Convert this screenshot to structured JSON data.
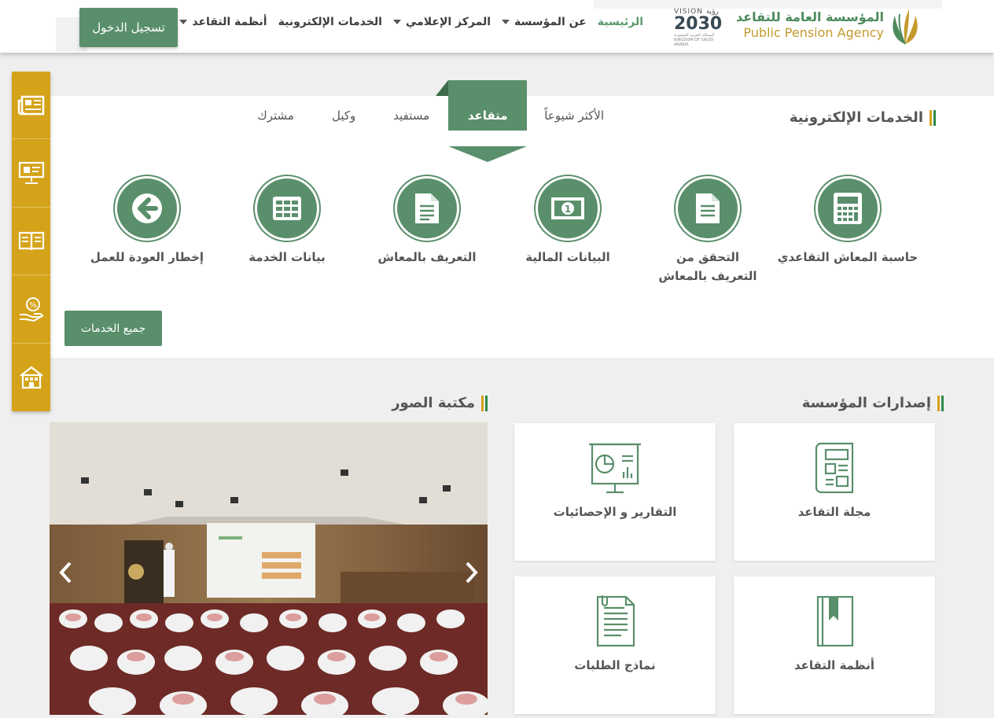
{
  "header": {
    "login_label": "تسجيل الدخول",
    "nav": [
      {
        "label": "الرئيسية",
        "active": true,
        "dropdown": false
      },
      {
        "label": "عن المؤسسة",
        "active": false,
        "dropdown": true
      },
      {
        "label": "المركز الإعلامي",
        "active": false,
        "dropdown": true
      },
      {
        "label": "الخدمات الإلكترونية",
        "active": false,
        "dropdown": false
      },
      {
        "label": "أنظمة التقاعد",
        "active": false,
        "dropdown": true
      }
    ],
    "vision": {
      "top": "VISION رؤية",
      "year": "2030",
      "sub": "المملكة العربية السعودية KINGDOM OF SAUDI ARABIA"
    },
    "logo": {
      "arabic": "المؤسسة العامة للتقاعد",
      "english": "Public Pension Agency"
    }
  },
  "sidebar": {
    "items": [
      {
        "icon": "newspaper-icon"
      },
      {
        "icon": "presentation-icon"
      },
      {
        "icon": "book-icon"
      },
      {
        "icon": "percent-hand-icon"
      },
      {
        "icon": "building-icon"
      }
    ]
  },
  "services": {
    "title": "الخدمات الإلكترونية",
    "tabs": [
      "الأكثر شيوعاً",
      "متقاعد",
      "مستفيد",
      "وكيل",
      "مشترك"
    ],
    "active_tab": "متقاعد",
    "items": [
      {
        "label": "حاسبة المعاش التقاعدي",
        "icon": "calculator-icon"
      },
      {
        "label": "التحقق من التعريف بالمعاش",
        "icon": "document-icon"
      },
      {
        "label": "البيانات المالية",
        "icon": "money-icon"
      },
      {
        "label": "التعريف بالمعاش",
        "icon": "document-lines-icon"
      },
      {
        "label": "بيانات الخدمة",
        "icon": "table-icon"
      },
      {
        "label": "إخطار العودة للعمل",
        "icon": "arrow-left-icon"
      }
    ],
    "all_button": "جميع الخدمات"
  },
  "publications": {
    "title": "إصدارات المؤسسة",
    "items": [
      {
        "label": "مجلة التقاعد",
        "icon": "magazine-icon"
      },
      {
        "label": "التقارير و الإحصائيات",
        "icon": "report-chart-icon"
      },
      {
        "label": "أنظمة التقاعد",
        "icon": "rules-book-icon"
      },
      {
        "label": "نماذج الطلبات",
        "icon": "forms-icon"
      }
    ]
  },
  "gallery": {
    "title": "مكتبة الصور"
  },
  "colors": {
    "green": "#5a8f6b",
    "gold": "#d4a31a",
    "logo_green": "#4c8a5c",
    "logo_gold": "#c59a2d"
  }
}
